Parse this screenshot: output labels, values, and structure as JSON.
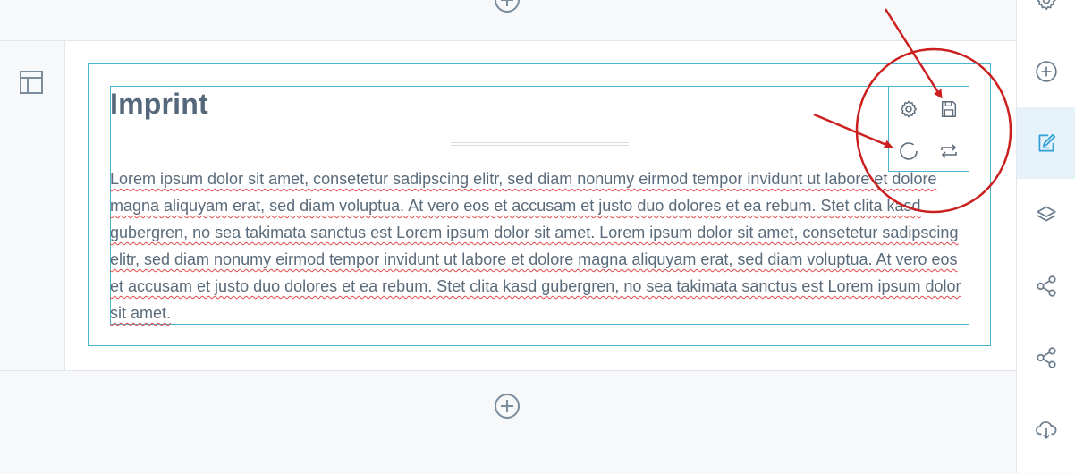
{
  "heading": {
    "title": "Imprint"
  },
  "content": {
    "paragraph": "Lorem ipsum dolor sit amet, consetetur sadipscing elitr, sed diam nonumy eirmod tempor invidunt ut labore et dolore magna aliquyam erat, sed diam voluptua. At vero eos et accusam et justo duo dolores et ea rebum. Stet clita kasd gubergren, no sea takimata sanctus est Lorem ipsum dolor sit amet. Lorem ipsum dolor sit amet, consetetur sadipscing elitr, sed diam nonumy eirmod tempor invidunt ut labore et dolore magna aliquyam erat, sed diam voluptua. At vero eos et accusam et justo duo dolores et ea rebum. Stet clita kasd gubergren, no sea takimata sanctus est Lorem ipsum dolor sit amet."
  },
  "toolbar": {
    "buttons": [
      "gear-icon",
      "save-icon",
      "reset-icon",
      "swap-icon"
    ]
  },
  "sidebar": {
    "items": [
      "gear-icon",
      "add-icon",
      "edit-icon",
      "layers-icon",
      "share-icon",
      "share-icon",
      "cloud-download-icon"
    ],
    "active_item": "edit-icon"
  },
  "colors": {
    "accent": "#4bb3cf",
    "annotation": "#cc1f1f",
    "text": "#5a6b7b",
    "sidebar_active": "#e6f3fb",
    "spellcheck_underline": "#e04a4a"
  }
}
